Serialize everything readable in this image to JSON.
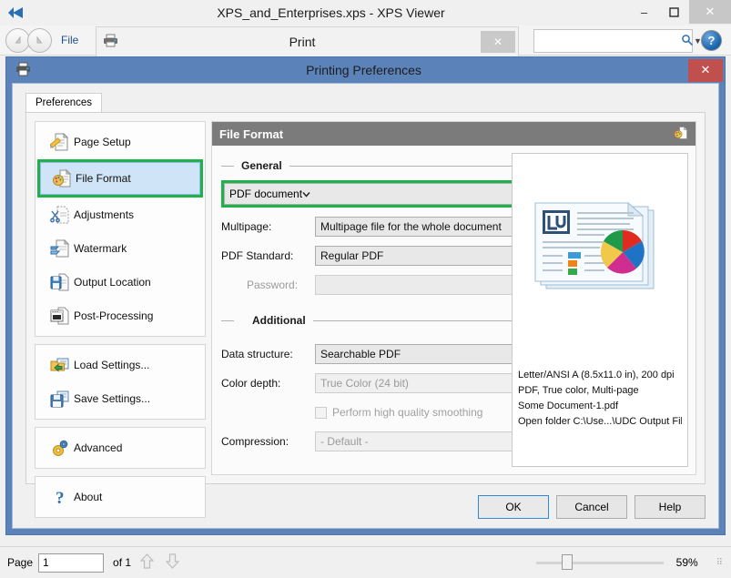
{
  "window": {
    "title": "XPS_and_Enterprises.xps - XPS Viewer",
    "app_icon": "xps-viewer-icon",
    "minimize": "–",
    "maximize": "❒",
    "close": "✕",
    "menu_file": "File",
    "nav_back": "◀",
    "nav_forward": "▶"
  },
  "toolbar": {
    "printer_icon": "printer-icon",
    "search_value": "",
    "search_placeholder": "",
    "search_icon": "search-icon",
    "search_caret": "▼",
    "help_icon": "?"
  },
  "print_window": {
    "title": "Print",
    "close": "✕",
    "icon": "printer-icon"
  },
  "dialog": {
    "title": "Printing Preferences",
    "icon": "printer-icon",
    "close": "✕",
    "tab": "Preferences",
    "header_accent": "#5b83b9",
    "highlight_color": "#1fb24a"
  },
  "sidebar": {
    "groups": [
      {
        "items": [
          {
            "label": "Page Setup",
            "icon": "page-setup-icon",
            "selected": false
          },
          {
            "label": "File Format",
            "icon": "file-format-icon",
            "selected": true,
            "highlighted": true
          },
          {
            "label": "Adjustments",
            "icon": "adjustments-icon",
            "selected": false
          },
          {
            "label": "Watermark",
            "icon": "watermark-icon",
            "selected": false
          },
          {
            "label": "Output Location",
            "icon": "output-location-icon",
            "selected": false
          },
          {
            "label": "Post-Processing",
            "icon": "post-processing-icon",
            "selected": false
          }
        ]
      },
      {
        "items": [
          {
            "label": "Load Settings...",
            "icon": "load-settings-icon",
            "selected": false
          },
          {
            "label": "Save Settings...",
            "icon": "save-settings-icon",
            "selected": false
          }
        ]
      },
      {
        "items": [
          {
            "label": "Advanced",
            "icon": "advanced-icon",
            "selected": false
          }
        ]
      },
      {
        "items": [
          {
            "label": "About",
            "icon": "about-icon",
            "selected": false
          }
        ]
      }
    ]
  },
  "panel": {
    "title": "File Format",
    "icon": "file-format-icon",
    "general_legend": "General",
    "additional_legend": "Additional",
    "format_value": "PDF document",
    "fields": [
      {
        "label": "Multipage:",
        "value": "Multipage file for the whole document",
        "disabled": false
      },
      {
        "label": "PDF Standard:",
        "value": "Regular PDF",
        "disabled": false
      }
    ],
    "password_label": "Password:",
    "password_value": "",
    "additional_fields": [
      {
        "label": "Data structure:",
        "value": "Searchable PDF",
        "disabled": false
      },
      {
        "label": "Color depth:",
        "value": "True Color (24 bit)",
        "disabled": true
      }
    ],
    "smoothing_label": "Perform high quality smoothing",
    "smoothing_checked": false,
    "compression_label": "Compression:",
    "compression_value": "- Default -",
    "dropdown_arrow": "⌄"
  },
  "preview": {
    "thumbnail_icon": "document-preview-icon",
    "lines": [
      "Letter/ANSI A (8.5x11.0 in), 200 dpi",
      "PDF, True color, Multi-page",
      "Some Document-1.pdf",
      "Open folder C:\\Use...\\UDC Output Files\\"
    ]
  },
  "buttons": {
    "ok": "OK",
    "cancel": "Cancel",
    "help": "Help"
  },
  "statusbar": {
    "page_label": "Page",
    "page_value": "1",
    "of_label": "of 1",
    "up_arrow": "⇧",
    "down_arrow": "⇩",
    "zoom_percent": "59%",
    "grip": "⁙"
  }
}
